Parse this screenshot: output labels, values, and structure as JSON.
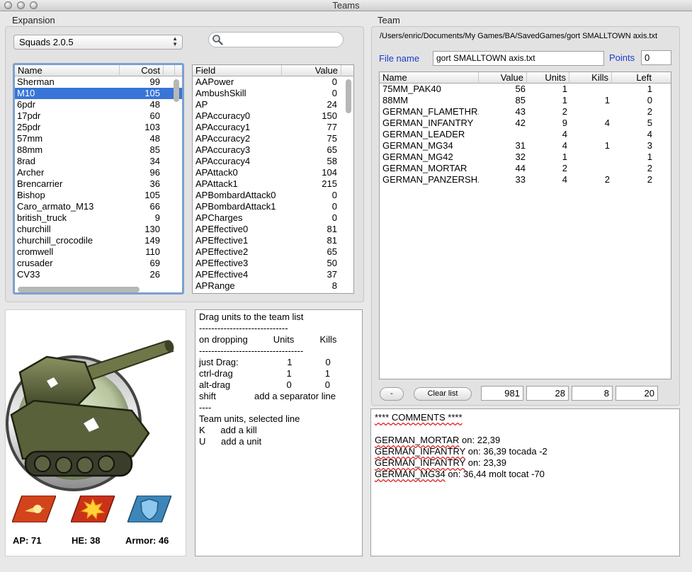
{
  "window": {
    "title": "Teams"
  },
  "expansion": {
    "label": "Expansion",
    "selected_squad": "Squads 2.0.5",
    "search_placeholder": "",
    "units_table": {
      "headers": {
        "name": "Name",
        "cost": "Cost"
      },
      "selected_index": 1,
      "rows": [
        {
          "name": "Sherman",
          "cost": "99"
        },
        {
          "name": "M10",
          "cost": "105"
        },
        {
          "name": "6pdr",
          "cost": "48"
        },
        {
          "name": "17pdr",
          "cost": "60"
        },
        {
          "name": "25pdr",
          "cost": "103"
        },
        {
          "name": "57mm",
          "cost": "48"
        },
        {
          "name": "88mm",
          "cost": "85"
        },
        {
          "name": "8rad",
          "cost": "34"
        },
        {
          "name": "Archer",
          "cost": "96"
        },
        {
          "name": "Brencarrier",
          "cost": "36"
        },
        {
          "name": "Bishop",
          "cost": "105"
        },
        {
          "name": "Caro_armato_M13",
          "cost": "66"
        },
        {
          "name": "british_truck",
          "cost": "9"
        },
        {
          "name": "churchill",
          "cost": "130"
        },
        {
          "name": "churchill_crocodile",
          "cost": "149"
        },
        {
          "name": "cromwell",
          "cost": "110"
        },
        {
          "name": "crusader",
          "cost": "69"
        },
        {
          "name": "CV33",
          "cost": "26"
        }
      ]
    },
    "fields_table": {
      "headers": {
        "field": "Field",
        "value": "Value"
      },
      "rows": [
        {
          "field": "AAPower",
          "value": "0"
        },
        {
          "field": "AmbushSkill",
          "value": "0"
        },
        {
          "field": "AP",
          "value": "24"
        },
        {
          "field": "APAccuracy0",
          "value": "150"
        },
        {
          "field": "APAccuracy1",
          "value": "77"
        },
        {
          "field": "APAccuracy2",
          "value": "75"
        },
        {
          "field": "APAccuracy3",
          "value": "65"
        },
        {
          "field": "APAccuracy4",
          "value": "58"
        },
        {
          "field": "APAttack0",
          "value": "104"
        },
        {
          "field": "APAttack1",
          "value": "215"
        },
        {
          "field": "APBombardAttack0",
          "value": "0"
        },
        {
          "field": "APBombardAttack1",
          "value": "0"
        },
        {
          "field": "APCharges",
          "value": "0"
        },
        {
          "field": "APEffective0",
          "value": "81"
        },
        {
          "field": "APEffective1",
          "value": "81"
        },
        {
          "field": "APEffective2",
          "value": "65"
        },
        {
          "field": "APEffective3",
          "value": "50"
        },
        {
          "field": "APEffective4",
          "value": "37"
        },
        {
          "field": "APRange",
          "value": "8"
        }
      ]
    }
  },
  "unit_stats": {
    "ap": "AP: 71",
    "he": "HE: 38",
    "armor": "Armor: 46"
  },
  "help": {
    "lines": [
      "Drag units to the team list",
      "-----------------------------",
      "on dropping          Units          Kills",
      "----------------------------------",
      "just Drag:                   1             0",
      "ctrl-drag                     1             1",
      "alt-drag                      0             0",
      "shift               add a separator line",
      "----",
      "Team units, selected line",
      "K      add a kill",
      "U      add a unit"
    ]
  },
  "team": {
    "label": "Team",
    "path": "/Users/enric/Documents/My Games/BA/SavedGames/gort SMALLTOWN axis.txt",
    "file_name_label": "File name",
    "file_name": "gort SMALLTOWN axis.txt",
    "points_label": "Points",
    "points": "0",
    "table": {
      "headers": {
        "name": "Name",
        "value": "Value",
        "units": "Units",
        "kills": "Kills",
        "left": "Left"
      },
      "rows": [
        {
          "name": "75MM_PAK40",
          "value": "56",
          "units": "1",
          "kills": "",
          "left": "1"
        },
        {
          "name": "88MM",
          "value": "85",
          "units": "1",
          "kills": "1",
          "left": "0"
        },
        {
          "name": "GERMAN_FLAMETHR...",
          "value": "43",
          "units": "2",
          "kills": "",
          "left": "2"
        },
        {
          "name": "GERMAN_INFANTRY",
          "value": "42",
          "units": "9",
          "kills": "4",
          "left": "5"
        },
        {
          "name": "GERMAN_LEADER",
          "value": "",
          "units": "4",
          "kills": "",
          "left": "4"
        },
        {
          "name": "GERMAN_MG34",
          "value": "31",
          "units": "4",
          "kills": "1",
          "left": "3"
        },
        {
          "name": "GERMAN_MG42",
          "value": "32",
          "units": "1",
          "kills": "",
          "left": "1"
        },
        {
          "name": "GERMAN_MORTAR",
          "value": "44",
          "units": "2",
          "kills": "",
          "left": "2"
        },
        {
          "name": "GERMAN_PANZERSH...",
          "value": "33",
          "units": "4",
          "kills": "2",
          "left": "2"
        }
      ]
    },
    "remove_label": "-",
    "clear_label": "Clear list",
    "totals": {
      "value": "981",
      "units": "28",
      "kills": "8",
      "left": "20"
    }
  },
  "comments": {
    "header": "**** COMMENTS ****",
    "lines": [
      {
        "unit": "GERMAN_MORTAR",
        "text": " on: 22,39"
      },
      {
        "unit": "GERMAN_INFANTRY",
        "text": " on: 36,39 tocada -2"
      },
      {
        "unit": "GERMAN_INFANTRY",
        "text": " on: 23,39"
      },
      {
        "unit": "GERMAN_MG34",
        "text": " on: 36,44 molt tocat -70"
      }
    ]
  },
  "colors": {
    "selection": "#3875d7",
    "accent_label": "#1a3ccc",
    "focus_ring": "#7ca0cf"
  },
  "icons": [
    "search-icon",
    "tank-portrait-icon",
    "ap-attack-icon",
    "he-attack-icon",
    "armor-shield-icon"
  ]
}
